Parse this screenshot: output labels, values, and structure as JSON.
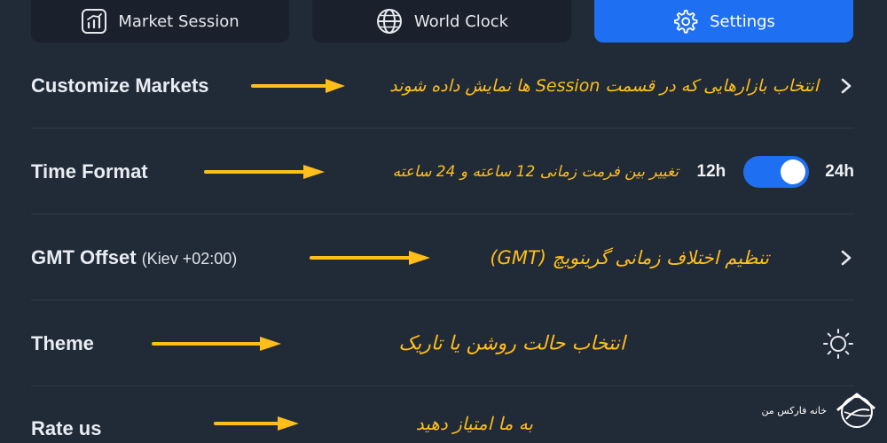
{
  "tabs": [
    {
      "label": "Market Session",
      "icon": "chart-icon",
      "active": false
    },
    {
      "label": "World Clock",
      "icon": "globe-icon",
      "active": false
    },
    {
      "label": "Settings",
      "icon": "gear-icon",
      "active": true
    }
  ],
  "settings": {
    "customize_markets": {
      "title": "Customize Markets",
      "note": "انتخاب بازارهایی که در قسمت Session ها نمایش داده شوند"
    },
    "time_format": {
      "title": "Time Format",
      "note": "تغییر بین فرمت زمانی 12 ساعته و 24 ساعته",
      "option_left": "12h",
      "option_right": "24h",
      "selected": "24h"
    },
    "gmt_offset": {
      "title": "GMT Offset",
      "value": "(Kiev +02:00)",
      "note": "تنظیم اختلاف زمانی گرینویچ (GMT)"
    },
    "theme": {
      "title": "Theme",
      "note": "انتخاب حالت روشن یا تاریک",
      "icon": "sun-icon"
    },
    "rate_us": {
      "title": "Rate us",
      "note": "به ما امتیاز دهید"
    }
  },
  "watermark": {
    "text": "خانه فارکس من"
  },
  "colors": {
    "background": "#212a37",
    "tab_bg": "#1a212c",
    "accent": "#1f6ff2",
    "annotation": "#ffbe1a"
  }
}
